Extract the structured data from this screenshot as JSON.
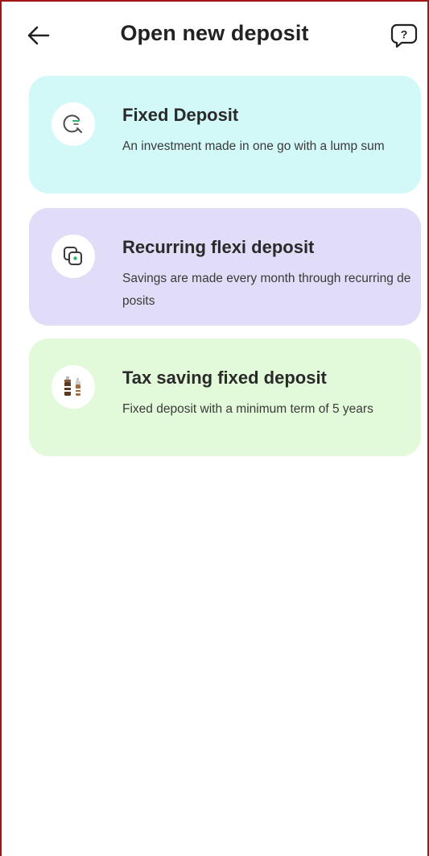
{
  "header": {
    "title": "Open new deposit",
    "back_icon": "arrow-left-icon",
    "help_icon": "help-chat-icon"
  },
  "deposit_options": [
    {
      "title": "Fixed Deposit",
      "description": "An investment made in one go with a lump sum",
      "icon": "magnifier-clock-icon",
      "background": "#d3f8f8"
    },
    {
      "title": "Recurring flexi deposit",
      "description": "Savings are made every month through recurring deposits",
      "icon": "recurring-cards-icon",
      "background": "#e1dcf7"
    },
    {
      "title": "Tax saving fixed deposit",
      "description": "Fixed deposit with a minimum term of 5 years",
      "icon": "tax-bottles-icon",
      "background": "#e2fad9"
    }
  ],
  "colors": {
    "frame_border": "#a31616",
    "accent_green": "#2fb36a"
  }
}
